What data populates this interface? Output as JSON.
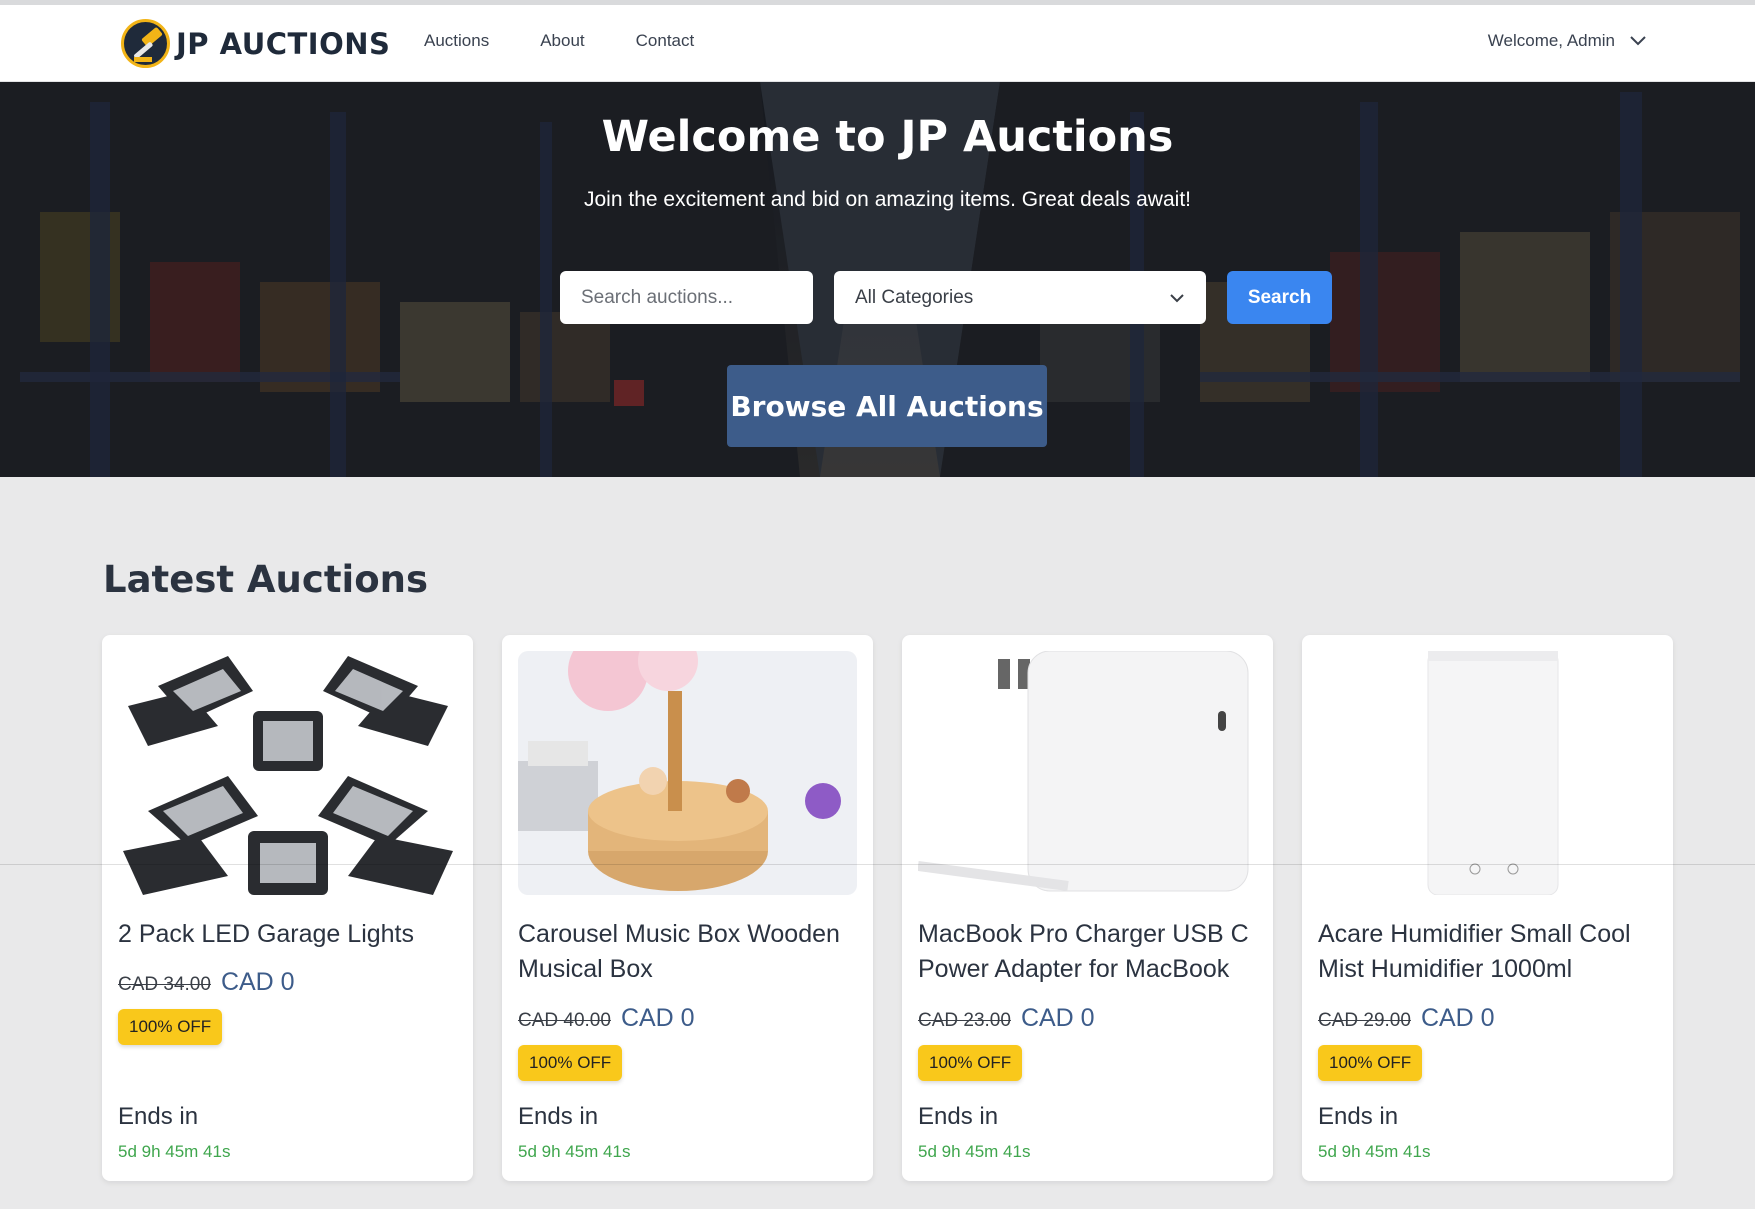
{
  "nav": {
    "brand": "JP AUCTIONS",
    "links": [
      "Auctions",
      "About",
      "Contact"
    ],
    "user": "Welcome, Admin"
  },
  "hero": {
    "title": "Welcome to JP Auctions",
    "subtitle": "Join the excitement and bid on amazing items. Great deals await!",
    "search_placeholder": "Search auctions...",
    "category_selected": "All Categories",
    "search_label": "Search",
    "browse_label": "Browse All Auctions"
  },
  "latest": {
    "title": "Latest Auctions",
    "ends_label": "Ends in",
    "cards": [
      {
        "title": "2 Pack LED Garage Lights",
        "old_price": "CAD 34.00",
        "new_price": "CAD 0",
        "badge": "100% OFF",
        "countdown": "5d 9h 45m 41s"
      },
      {
        "title": "Carousel Music Box Wooden Musical Box",
        "old_price": "CAD 40.00",
        "new_price": "CAD 0",
        "badge": "100% OFF",
        "countdown": "5d 9h 45m 41s"
      },
      {
        "title": "MacBook Pro Charger USB C Power Adapter for MacBook",
        "old_price": "CAD 23.00",
        "new_price": "CAD 0",
        "badge": "100% OFF",
        "countdown": "5d 9h 45m 41s"
      },
      {
        "title": "Acare Humidifier Small Cool Mist Humidifier 1000ml",
        "old_price": "CAD 29.00",
        "new_price": "CAD 0",
        "badge": "100% OFF",
        "countdown": "5d 9h 45m 41s"
      }
    ]
  },
  "colors": {
    "primary": "#3d5c8a",
    "search_button": "#3a86f0",
    "badge": "#f9c81b",
    "countdown": "#3fa64d"
  }
}
